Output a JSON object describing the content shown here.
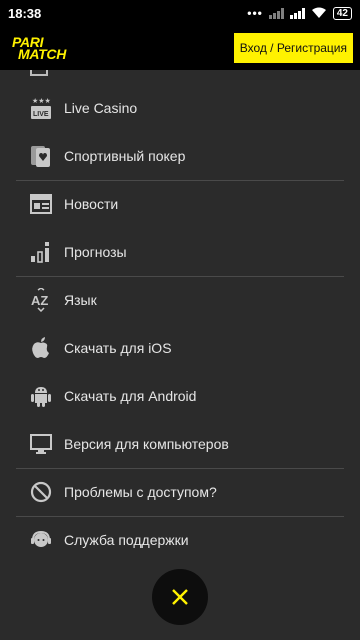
{
  "status": {
    "time": "18:38",
    "battery": "42"
  },
  "header": {
    "logo_line1": "PARI",
    "logo_line2": "MATCH",
    "login_label": "Вход / Регистрация"
  },
  "menu": {
    "items": [
      {
        "label": "Live Casino",
        "icon": "live-casino-icon"
      },
      {
        "label": "Спортивный покер",
        "icon": "poker-cards-icon"
      },
      {
        "label": "Новости",
        "icon": "news-icon"
      },
      {
        "label": "Прогнозы",
        "icon": "forecast-icon"
      },
      {
        "label": "Язык",
        "icon": "language-az-icon"
      },
      {
        "label": "Скачать для iOS",
        "icon": "apple-icon"
      },
      {
        "label": "Скачать для Android",
        "icon": "android-icon"
      },
      {
        "label": "Версия для компьютеров",
        "icon": "desktop-monitor-icon"
      },
      {
        "label": "Проблемы с доступом?",
        "icon": "blocked-icon"
      },
      {
        "label": "Служба поддержки",
        "icon": "support-icon"
      }
    ]
  },
  "colors": {
    "accent": "#fff200",
    "background": "#2b2b2b",
    "header": "#000000"
  }
}
